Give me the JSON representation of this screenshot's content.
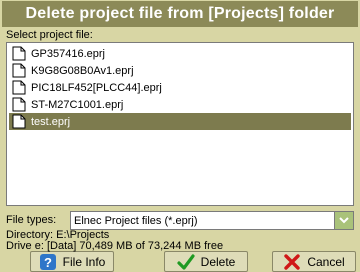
{
  "window": {
    "title": "Delete project file from [Projects] folder"
  },
  "file_list": {
    "label": "Select project file:",
    "items": [
      {
        "name": "GP357416.eprj",
        "selected": false
      },
      {
        "name": "K9G8G08B0Av1.eprj",
        "selected": false
      },
      {
        "name": "PIC18LF452[PLCC44].eprj",
        "selected": false
      },
      {
        "name": "ST-M27C1001.eprj",
        "selected": false
      },
      {
        "name": "test.eprj",
        "selected": true
      }
    ]
  },
  "file_types": {
    "label": "File types:",
    "selected_value": "Elnec Project files (*.eprj)"
  },
  "info": {
    "directory": "Directory: E:\\Projects",
    "drive": "Drive e: [Data]  70,489 MB of 73,244 MB free"
  },
  "buttons": {
    "file_info": "File Info",
    "delete": "Delete",
    "cancel": "Cancel"
  },
  "colors": {
    "title_bar": "#8c8a58",
    "selection": "#7d7b4e",
    "background": "#d8d6a4"
  },
  "icons": {
    "file": "document-icon",
    "dropdown": "chevron-down-icon",
    "file_info": "help-icon",
    "delete": "checkmark-icon",
    "cancel": "x-icon"
  }
}
